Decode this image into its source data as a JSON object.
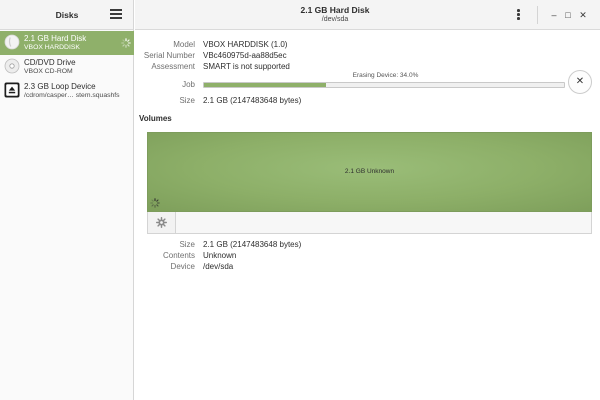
{
  "sidebar": {
    "title": "Disks",
    "devices": [
      {
        "title": "2.1 GB Hard Disk",
        "subtitle": "VBOX HARDDISK",
        "icon": "hard-disk-icon",
        "selected": true
      },
      {
        "title": "CD/DVD Drive",
        "subtitle": "VBOX CD-ROM",
        "icon": "optical-disc-icon",
        "selected": false
      },
      {
        "title": "2.3 GB Loop Device",
        "subtitle": "/cdrom/casper… stem.squashfs",
        "icon": "eject-icon",
        "selected": false
      }
    ]
  },
  "header": {
    "title": "2.1 GB Hard Disk",
    "subtitle": "/dev/sda",
    "minimize": "–",
    "maximize": "□",
    "close": "✕"
  },
  "details": {
    "model_label": "Model",
    "model": "VBOX HARDDISK (1.0)",
    "serial_label": "Serial Number",
    "serial": "VBc460975d-aa88d5ec",
    "assessment_label": "Assessment",
    "assessment": "SMART is not supported",
    "job_label": "Job",
    "job_text": "Erasing Device: 34.0%",
    "job_progress": 34.0,
    "size_label": "Size",
    "size": "2.1 GB (2147483648 bytes)",
    "cancel": "✕"
  },
  "volumes": {
    "title": "Volumes",
    "partition_label": "2.1 GB Unknown",
    "size_label": "Size",
    "size": "2.1 GB (2147483648 bytes)",
    "contents_label": "Contents",
    "contents": "Unknown",
    "device_label": "Device",
    "device": "/dev/sda"
  },
  "colors": {
    "accent": "#8fb06a",
    "volume": "#8daf68"
  }
}
